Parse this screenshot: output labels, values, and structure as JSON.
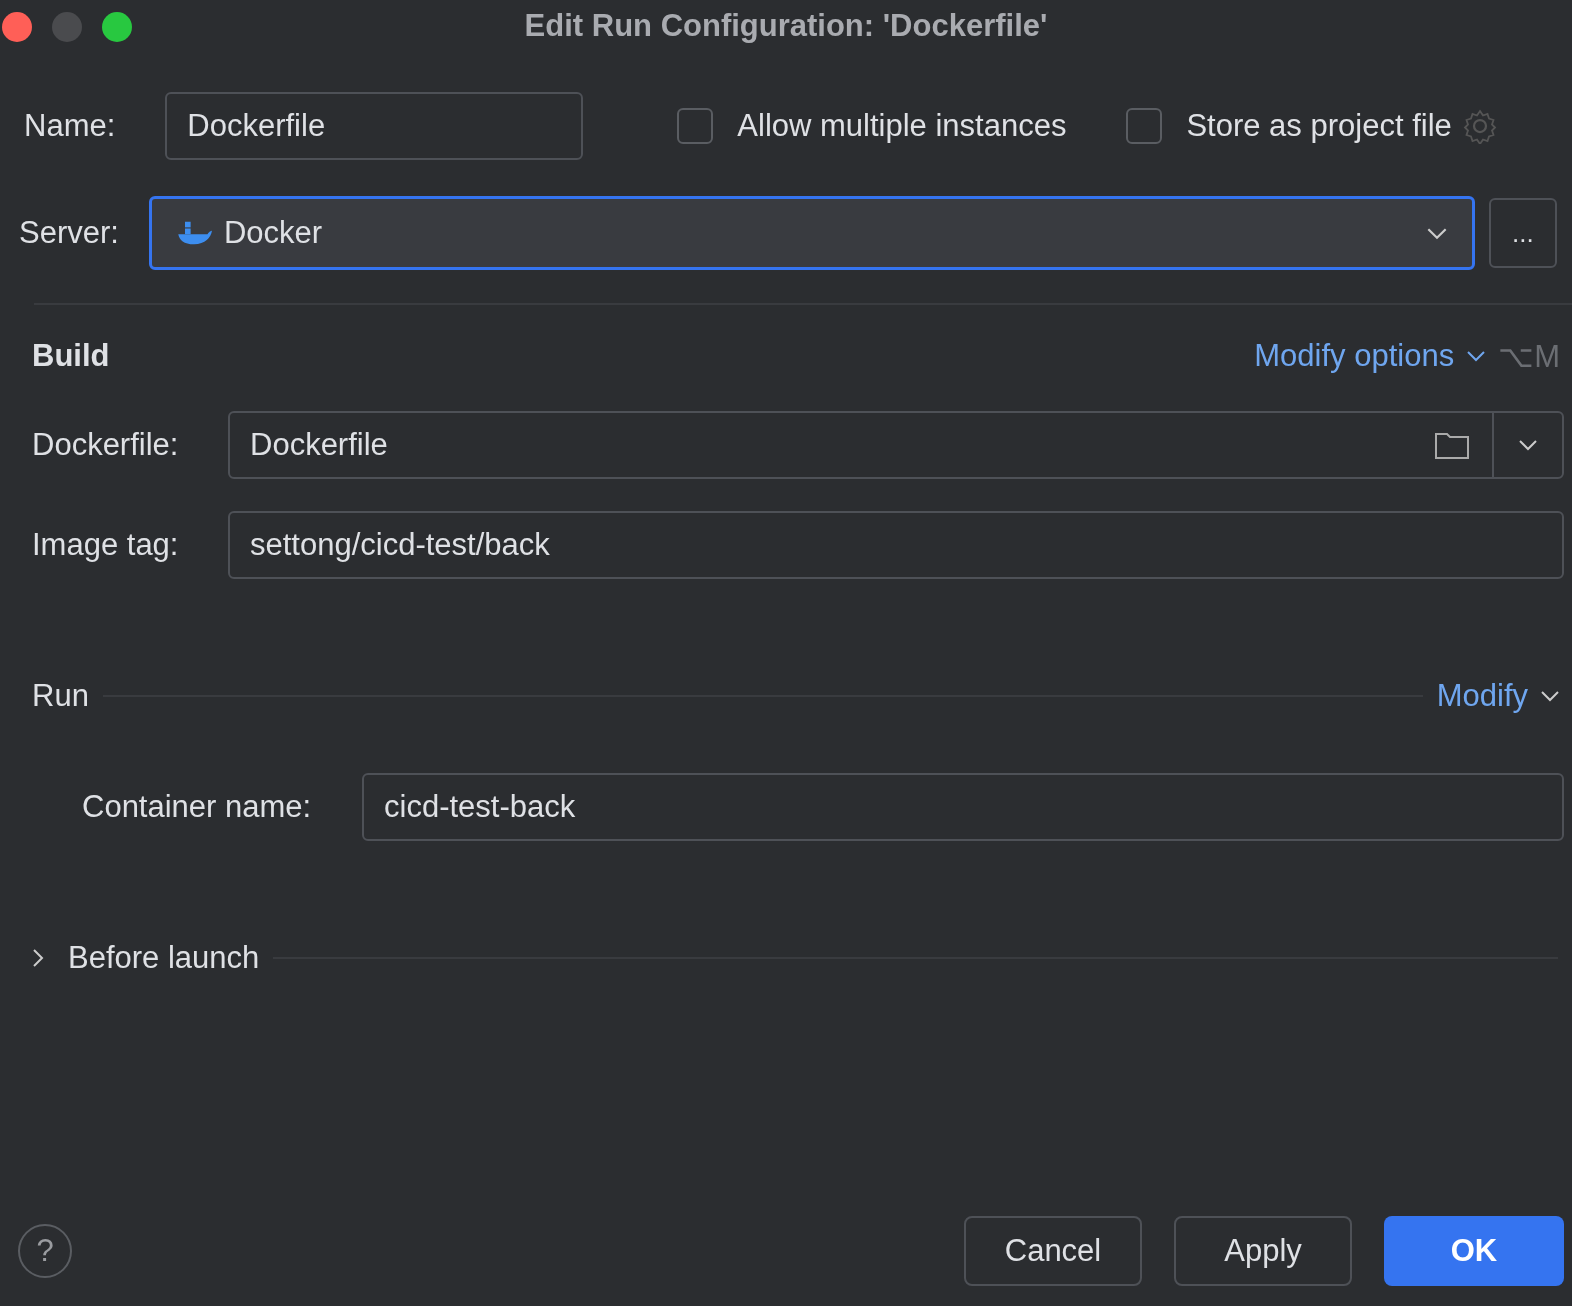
{
  "window": {
    "title": "Edit Run Configuration: 'Dockerfile'"
  },
  "name_row": {
    "label": "Name:",
    "value": "Dockerfile",
    "options": [
      {
        "label": "Allow multiple instances",
        "checked": false
      },
      {
        "label": "Store as project file",
        "checked": false
      }
    ]
  },
  "server": {
    "label": "Server:",
    "value": "Docker",
    "focused": true,
    "browse": "..."
  },
  "build": {
    "title": "Build",
    "modify": "Modify options",
    "shortcut": "⌥M",
    "fields": [
      {
        "kind": "combo",
        "label": "Dockerfile:",
        "value": "Dockerfile"
      },
      {
        "kind": "text",
        "label": "Image tag:",
        "value": "settong/cicd-test/back"
      }
    ]
  },
  "run": {
    "title": "Run",
    "modify": "Modify",
    "fields": [
      {
        "label": "Container name:",
        "value": "cicd-test-back"
      }
    ]
  },
  "before_launch": {
    "title": "Before launch",
    "expanded": false
  },
  "help": "?",
  "buttons": [
    {
      "label": "Cancel",
      "kind": "secondary"
    },
    {
      "label": "Apply",
      "kind": "secondary"
    },
    {
      "label": "OK",
      "kind": "primary"
    }
  ]
}
